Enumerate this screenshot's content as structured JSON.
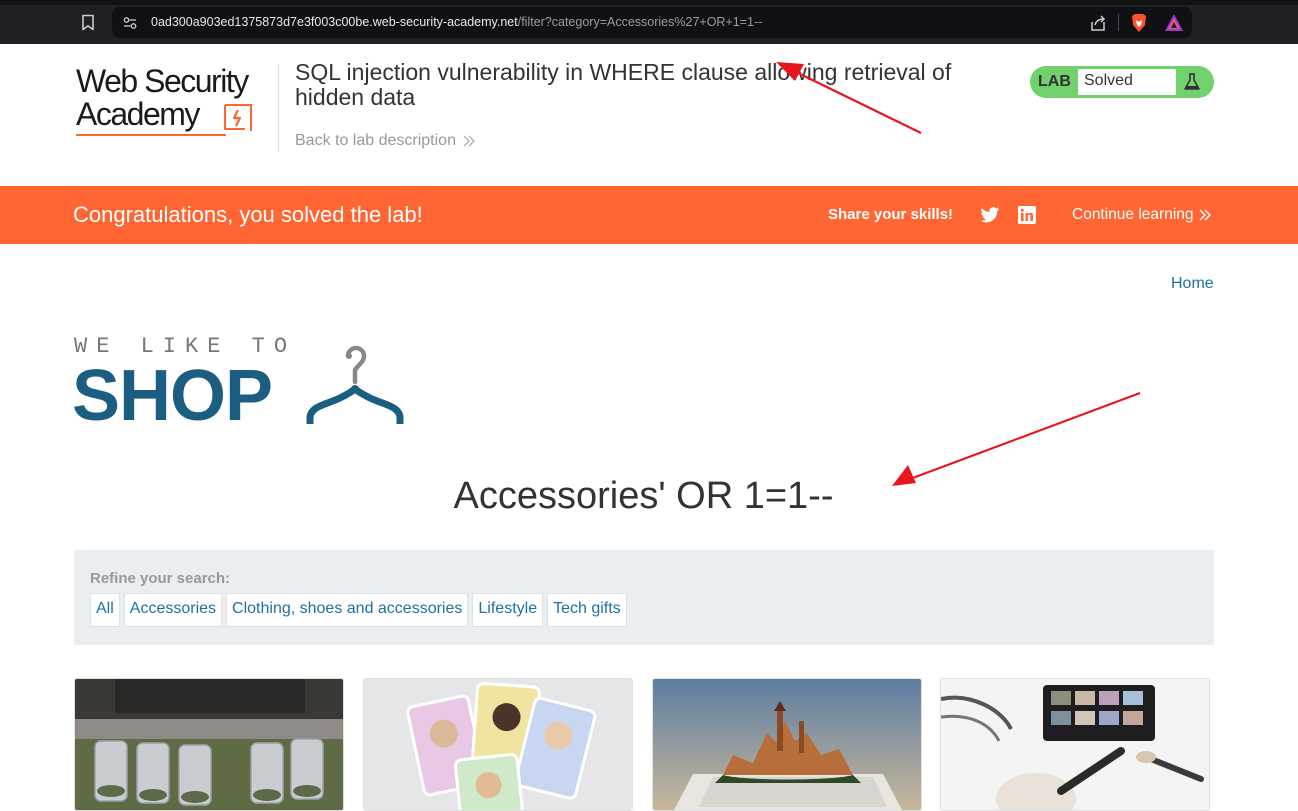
{
  "browser": {
    "url_host": "0ad300a903ed1375873d7e3f003c00be.web-security-academy.net",
    "url_path": "/filter?category=Accessories%27+OR+1=1--"
  },
  "header": {
    "logo_line1": "Web Security",
    "logo_line2": "Academy",
    "lab_title": "SQL injection vulnerability in WHERE clause allowing retrieval of hidden data",
    "back_link": "Back to lab description",
    "lab_tag": "LAB",
    "lab_status": "Solved"
  },
  "banner": {
    "title": "Congratulations, you solved the lab!",
    "share_label": "Share your skills!",
    "continue_label": "Continue learning"
  },
  "shop": {
    "home_link": "Home",
    "tagline": "WE LIKE TO",
    "logo_word": "SHOP",
    "heading": "Accessories' OR 1=1--",
    "refine_label": "Refine your search:",
    "categories": [
      "All",
      "Accessories",
      "Clothing, shoes and accessories",
      "Lifestyle",
      "Tech gifts"
    ]
  },
  "colors": {
    "accent_orange": "#ff6633",
    "solved_green": "#70d16d",
    "link_blue": "#1f6fa8",
    "shop_blue": "#1b5e82",
    "annotation_red": "#e8161c"
  }
}
